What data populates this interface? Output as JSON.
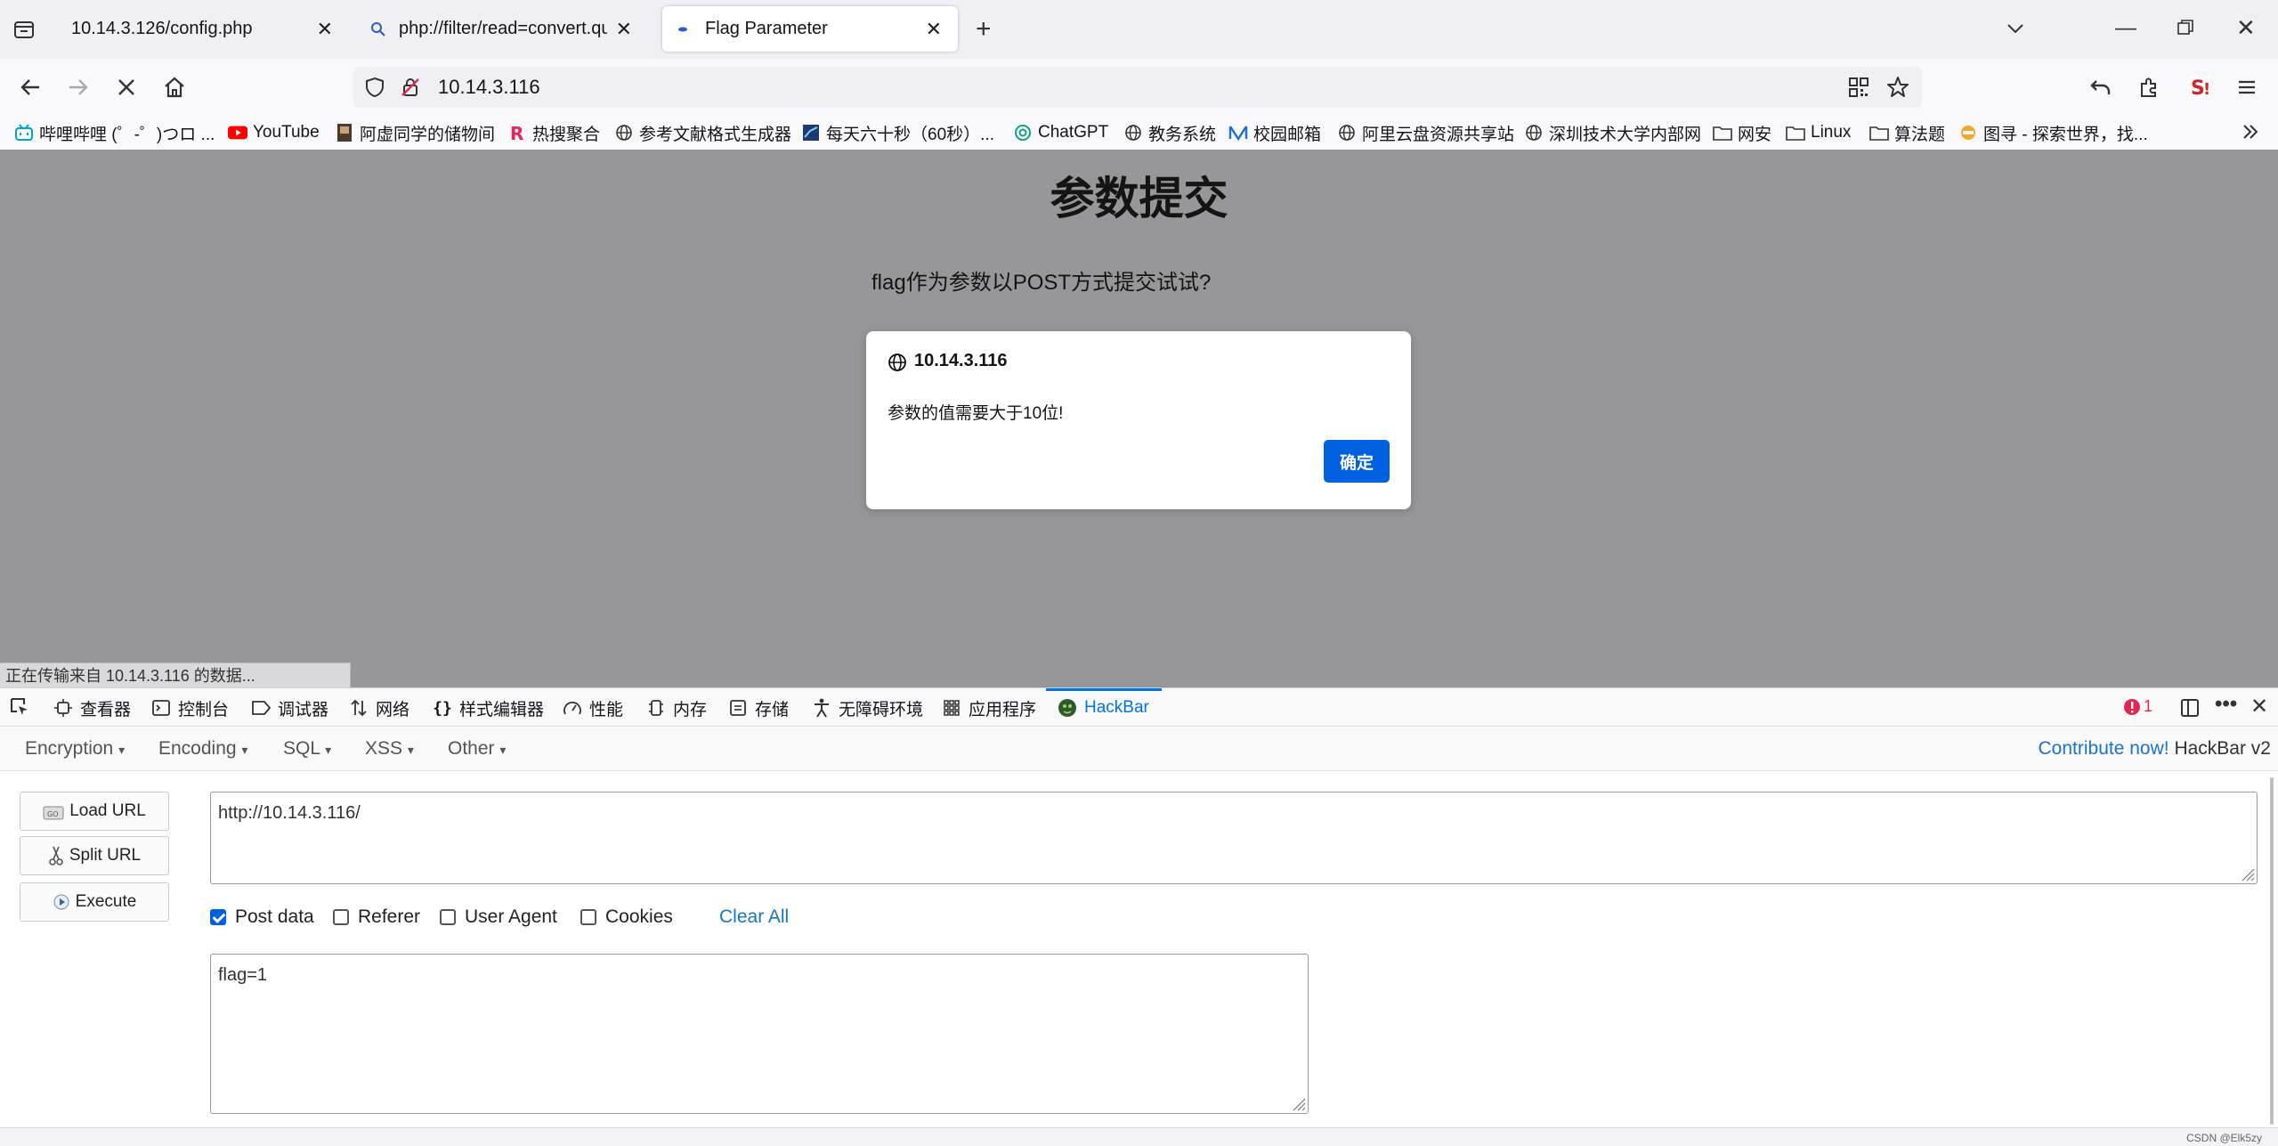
{
  "tabs": [
    {
      "label": "10.14.3.126/config.php",
      "active": false
    },
    {
      "label": "php://filter/read=convert.quoted-printable-encode/resource=config.php",
      "active": false
    },
    {
      "label": "Flag Parameter",
      "active": true
    }
  ],
  "nav": {
    "url": "10.14.3.116"
  },
  "bookmarks": [
    {
      "label": "哔哩哔哩 (゜-゜)つロ ...",
      "icon": "bilibili-icon"
    },
    {
      "label": "YouTube",
      "icon": "youtube-icon"
    },
    {
      "label": "阿虚同学的储物间",
      "icon": "site-icon"
    },
    {
      "label": "热搜聚合",
      "icon": "r-icon"
    },
    {
      "label": "参考文献格式生成器",
      "icon": "globe-icon"
    },
    {
      "label": "每天六十秒（60秒）...",
      "icon": "site-icon"
    },
    {
      "label": "ChatGPT",
      "icon": "chatgpt-icon"
    },
    {
      "label": "教务系统",
      "icon": "globe-icon"
    },
    {
      "label": "校园邮箱",
      "icon": "mail-icon"
    },
    {
      "label": "阿里云盘资源共享站",
      "icon": "globe-icon"
    },
    {
      "label": "深圳技术大学内部网",
      "icon": "globe-icon"
    },
    {
      "label": "网安",
      "icon": "folder-icon"
    },
    {
      "label": "Linux",
      "icon": "folder-icon"
    },
    {
      "label": "算法题",
      "icon": "folder-icon"
    },
    {
      "label": "图寻 - 探索世界，找...",
      "icon": "site-icon"
    }
  ],
  "page": {
    "title": "参数提交",
    "prompt": "flag作为参数以POST方式提交试试?"
  },
  "dialog": {
    "host": "10.14.3.116",
    "message": "参数的值需要大于10位!",
    "ok_label": "确定"
  },
  "status_text": "正在传输来自 10.14.3.116 的数据...",
  "devtools": {
    "tabs": [
      {
        "label": "查看器",
        "icon": "inspector-icon"
      },
      {
        "label": "控制台",
        "icon": "console-icon"
      },
      {
        "label": "调试器",
        "icon": "debugger-icon"
      },
      {
        "label": "网络",
        "icon": "network-icon"
      },
      {
        "label": "样式编辑器",
        "icon": "style-editor-icon"
      },
      {
        "label": "性能",
        "icon": "performance-icon"
      },
      {
        "label": "内存",
        "icon": "memory-icon"
      },
      {
        "label": "存储",
        "icon": "storage-icon"
      },
      {
        "label": "无障碍环境",
        "icon": "accessibility-icon"
      },
      {
        "label": "应用程序",
        "icon": "application-icon"
      },
      {
        "label": "HackBar",
        "icon": "hackbar-icon"
      }
    ],
    "error_count": "1"
  },
  "hackbar": {
    "menus": [
      "Encryption",
      "Encoding",
      "SQL",
      "XSS",
      "Other"
    ],
    "contribute": "Contribute now!",
    "version": "HackBar v2",
    "buttons": {
      "load": "Load URL",
      "split": "Split URL",
      "execute": "Execute"
    },
    "url_value": "http://10.14.3.116/",
    "options": [
      {
        "label": "Post data",
        "checked": true
      },
      {
        "label": "Referer",
        "checked": false
      },
      {
        "label": "User Agent",
        "checked": false
      },
      {
        "label": "Cookies",
        "checked": false
      }
    ],
    "clear_all": "Clear All",
    "post_value": "flag=1"
  },
  "watermark": "CSDN @Elk5zy",
  "colors": {
    "accent": "#0061e0",
    "overlay": "#979799",
    "link": "#1a73c8"
  }
}
